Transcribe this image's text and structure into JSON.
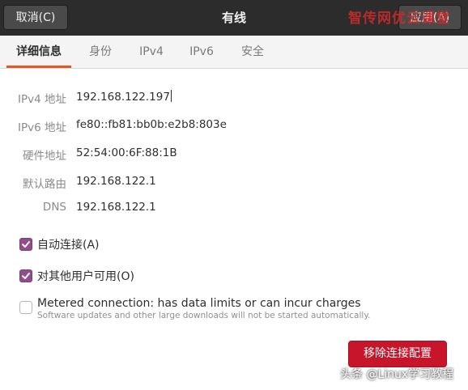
{
  "header": {
    "title": "有线",
    "cancel_label": "取消(C)",
    "apply_label": "应用(A)",
    "watermark": "智传网优云课堂"
  },
  "tabs": [
    {
      "label": "详细信息",
      "active": true
    },
    {
      "label": "身份",
      "active": false
    },
    {
      "label": "IPv4",
      "active": false
    },
    {
      "label": "IPv6",
      "active": false
    },
    {
      "label": "安全",
      "active": false
    }
  ],
  "details": [
    {
      "label": "IPv4 地址",
      "value": "192.168.122.197"
    },
    {
      "label": "IPv6 地址",
      "value": "fe80::fb81:bb0b:e2b8:803e"
    },
    {
      "label": "硬件地址",
      "value": "52:54:00:6F:88:1B"
    },
    {
      "label": "默认路由",
      "value": "192.168.122.1"
    },
    {
      "label": "DNS",
      "value": "192.168.122.1"
    }
  ],
  "options": {
    "auto_connect": {
      "label": "自动连接(A)",
      "checked": true
    },
    "all_users": {
      "label": "对其他用户可用(O)",
      "checked": true
    },
    "metered": {
      "title": "Metered connection: has data limits or can incur charges",
      "subtitle": "Software updates and other large downloads will not be started automatically.",
      "checked": false
    }
  },
  "remove_button_label": "移除连接配置",
  "footer_watermark": "头条 @Linux学习教程",
  "colors": {
    "header_bg": "#2c2c2c",
    "tab_accent": "#e95420",
    "checkbox_checked": "#924d8b",
    "destructive": "#c7162b"
  }
}
